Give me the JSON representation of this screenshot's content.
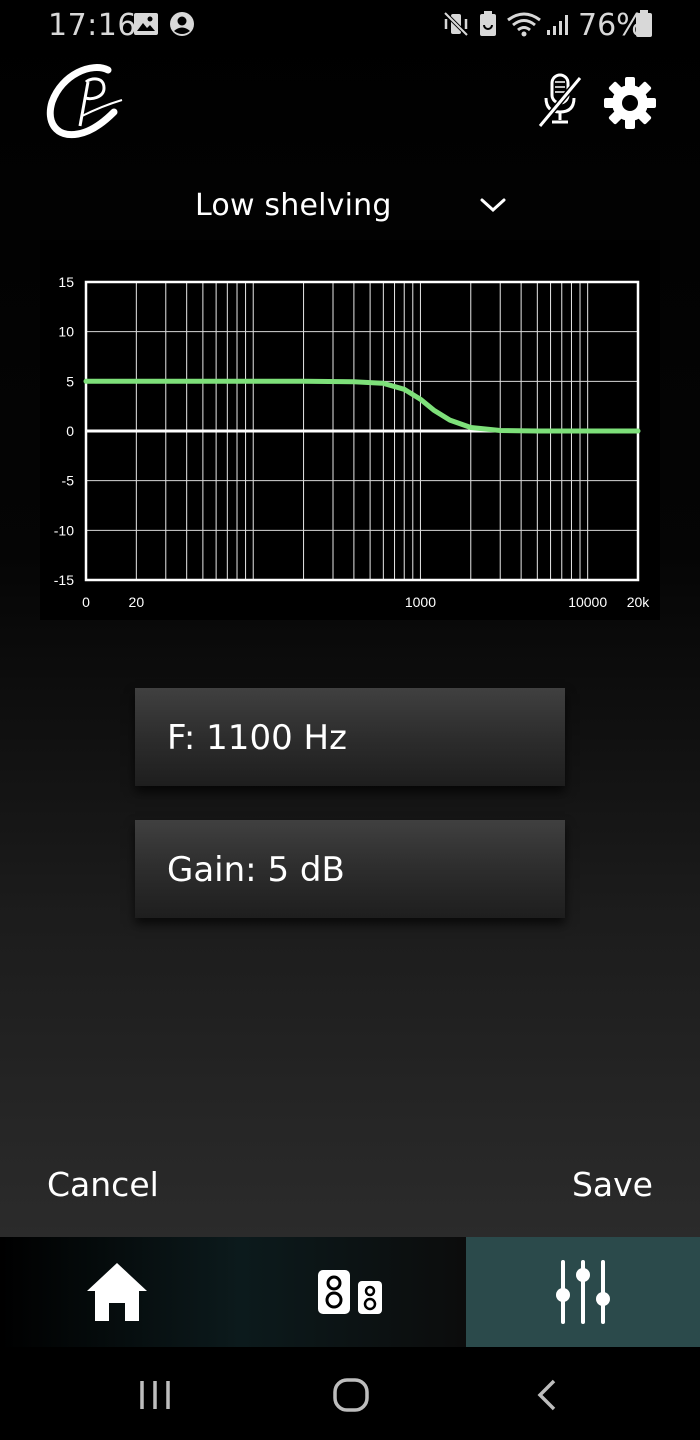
{
  "status_bar": {
    "time": "17:16",
    "battery": "76%",
    "left_icons": [
      "gallery-icon",
      "account-circle-icon"
    ],
    "right_icons": [
      "vibrate-mute-icon",
      "battery-saver-icon",
      "wifi-icon",
      "signal-icon",
      "battery-icon"
    ]
  },
  "header": {
    "logo": "app-logo",
    "mic_icon": "microphone-off-icon",
    "settings_icon": "gear-icon"
  },
  "filter": {
    "selected": "Low shelving",
    "dropdown_icon": "chevron-down-icon"
  },
  "chart_data": {
    "type": "line",
    "series": [
      {
        "color": "#7ee07a",
        "x": [
          10,
          20,
          50,
          100,
          200,
          400,
          600,
          800,
          1000,
          1200,
          1500,
          2000,
          3000,
          5000,
          10000,
          20000
        ],
        "y": [
          5,
          5,
          5,
          5,
          5,
          4.95,
          4.8,
          4.2,
          3.2,
          2.1,
          1.1,
          0.35,
          0.05,
          0,
          0,
          0
        ]
      }
    ],
    "x_scale": "log",
    "xlim": [
      10,
      20000
    ],
    "ylim": [
      -15,
      15
    ],
    "x_ticks": [
      {
        "value": 10,
        "label": "0"
      },
      {
        "value": 20,
        "label": "20"
      },
      {
        "value": 1000,
        "label": "1000"
      },
      {
        "value": 10000,
        "label": "10000"
      },
      {
        "value": 20000,
        "label": "20k"
      }
    ],
    "y_ticks": [
      15,
      10,
      5,
      0,
      -5,
      -10,
      -15
    ],
    "y_tick_labels": [
      "15",
      "10",
      "5",
      "0",
      "-5",
      "-10",
      "-15"
    ],
    "zero_line": 0,
    "grid": true,
    "background": "#000000",
    "axis_color": "#ffffff"
  },
  "params": {
    "frequency": "F: 1100 Hz",
    "gain": "Gain: 5 dB"
  },
  "actions": {
    "cancel": "Cancel",
    "save": "Save"
  },
  "tabs": [
    {
      "icon": "home-icon",
      "active": false
    },
    {
      "icon": "speakers-icon",
      "active": false
    },
    {
      "icon": "equalizer-sliders-icon",
      "active": true
    }
  ],
  "colors": {
    "accent_tab": "#2b4a4b",
    "curve": "#7ee07a"
  }
}
